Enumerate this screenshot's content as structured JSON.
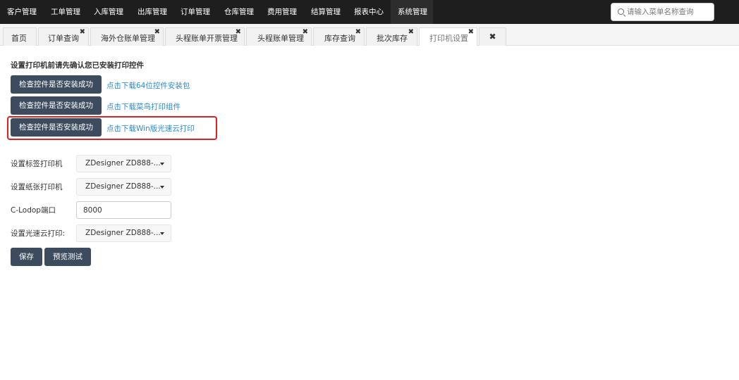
{
  "nav": {
    "items": [
      {
        "label": "客户管理",
        "active": false
      },
      {
        "label": "工单管理",
        "active": false
      },
      {
        "label": "入库管理",
        "active": false
      },
      {
        "label": "出库管理",
        "active": false
      },
      {
        "label": "订单管理",
        "active": false
      },
      {
        "label": "仓库管理",
        "active": false
      },
      {
        "label": "费用管理",
        "active": false
      },
      {
        "label": "结算管理",
        "active": false
      },
      {
        "label": "报表中心",
        "active": false
      },
      {
        "label": "系统管理",
        "active": true
      }
    ],
    "search_placeholder": "请输入菜单名称查询",
    "search_icon": "search-icon"
  },
  "tabs": [
    {
      "label": "首页",
      "closable": false,
      "active": false
    },
    {
      "label": "订单查询",
      "closable": true,
      "active": false
    },
    {
      "label": "海外仓账单管理",
      "closable": true,
      "active": false
    },
    {
      "label": "头程账单开票管理",
      "closable": true,
      "active": false
    },
    {
      "label": "头程账单管理",
      "closable": true,
      "active": false
    },
    {
      "label": "库存查询",
      "closable": true,
      "active": false
    },
    {
      "label": "批次库存",
      "closable": true,
      "active": false
    },
    {
      "label": "打印机设置",
      "closable": true,
      "active": true
    }
  ],
  "tab_close_glyph": "✖",
  "printer": {
    "notice": "设置打印机前请先确认您已安装打印控件",
    "checks": [
      {
        "button": "检查控件是否安装成功",
        "link": "点击下载64位控件安装包"
      },
      {
        "button": "检查控件是否安装成功",
        "link": "点击下载菜鸟打印组件"
      },
      {
        "button": "检查控件是否安装成功",
        "link": "点击下载Win版光速云打印",
        "highlighted": true
      }
    ],
    "label_printer": {
      "label": "设置标签打印机",
      "value": "ZDesigner ZD888-..."
    },
    "paper_printer": {
      "label": "设置纸张打印机",
      "value": "ZDesigner ZD888-..."
    },
    "clodop_port": {
      "label": "C-Lodop端口",
      "value": "8000"
    },
    "cloud_printer": {
      "label": "设置光速云打印:",
      "value": "ZDesigner ZD888-..."
    },
    "save_label": "保存",
    "preview_label": "预览测试"
  },
  "colors": {
    "nav_bg": "#1e1e1e",
    "button_bg": "#3d4b5e",
    "link": "#2a8bd1",
    "highlight_border": "#e02020"
  }
}
